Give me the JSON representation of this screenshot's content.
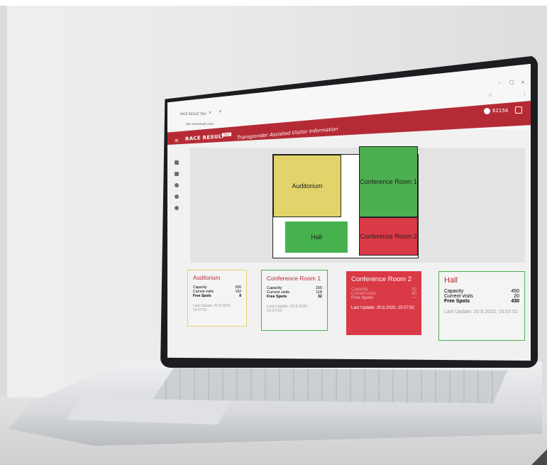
{
  "browser": {
    "tab_label": "RACE RESULT TAVI",
    "tab_close": "×",
    "new_tab": "+",
    "url": "tavi.raceresult.com",
    "minimize": "–",
    "maximize": "□",
    "close": "×",
    "bookmark": "☆",
    "menu": "⋮"
  },
  "appbar": {
    "menu_icon": "≡",
    "brand": "RACE RESULT",
    "badge": "TAVI",
    "title": "Transponder Assisted Visitor Information",
    "user_id": "62156",
    "colors": {
      "bar": "#b52b35"
    }
  },
  "floorplan": {
    "rooms": [
      {
        "name": "Auditorium",
        "status": "yellow",
        "color": "#e2d36a"
      },
      {
        "name": "Conference Room 1",
        "status": "green",
        "color": "#4caf50"
      },
      {
        "name": "Hall",
        "status": "green",
        "color": "#45b24e"
      },
      {
        "name": "Conference Room 2",
        "status": "red",
        "color": "#d93a46"
      }
    ]
  },
  "cards": [
    {
      "title": "Auditorium",
      "capacity_label": "Capacity",
      "capacity": "200",
      "visits_label": "Current visits",
      "visits": "192",
      "free_label": "Free Spots",
      "free": "8",
      "updated": "Last Update: 20.8.2020, 15:07:52",
      "border": "#e2d36a"
    },
    {
      "title": "Conference Room 1",
      "capacity_label": "Capacity",
      "capacity": "150",
      "visits_label": "Current visits",
      "visits": "118",
      "free_label": "Free Spots",
      "free": "32",
      "updated": "Last Update: 20.8.2020, 15:07:52",
      "border": "#4caf50"
    },
    {
      "title": "Conference Room 2",
      "capacity_label": "Capacity",
      "capacity": "80",
      "visits_label": "Current visits",
      "visits": "80",
      "free_label": "Free Spots",
      "free": "---",
      "updated": "Last Update: 20.8.2020, 15:07:52",
      "fill": "#d93a46"
    },
    {
      "title": "Hall",
      "capacity_label": "Capacity",
      "capacity": "450",
      "visits_label": "Current visits",
      "visits": "20",
      "free_label": "Free Spots",
      "free": "430",
      "updated": "Last Update: 20.8.2020, 15:07:52",
      "border": "#4caf50"
    }
  ]
}
